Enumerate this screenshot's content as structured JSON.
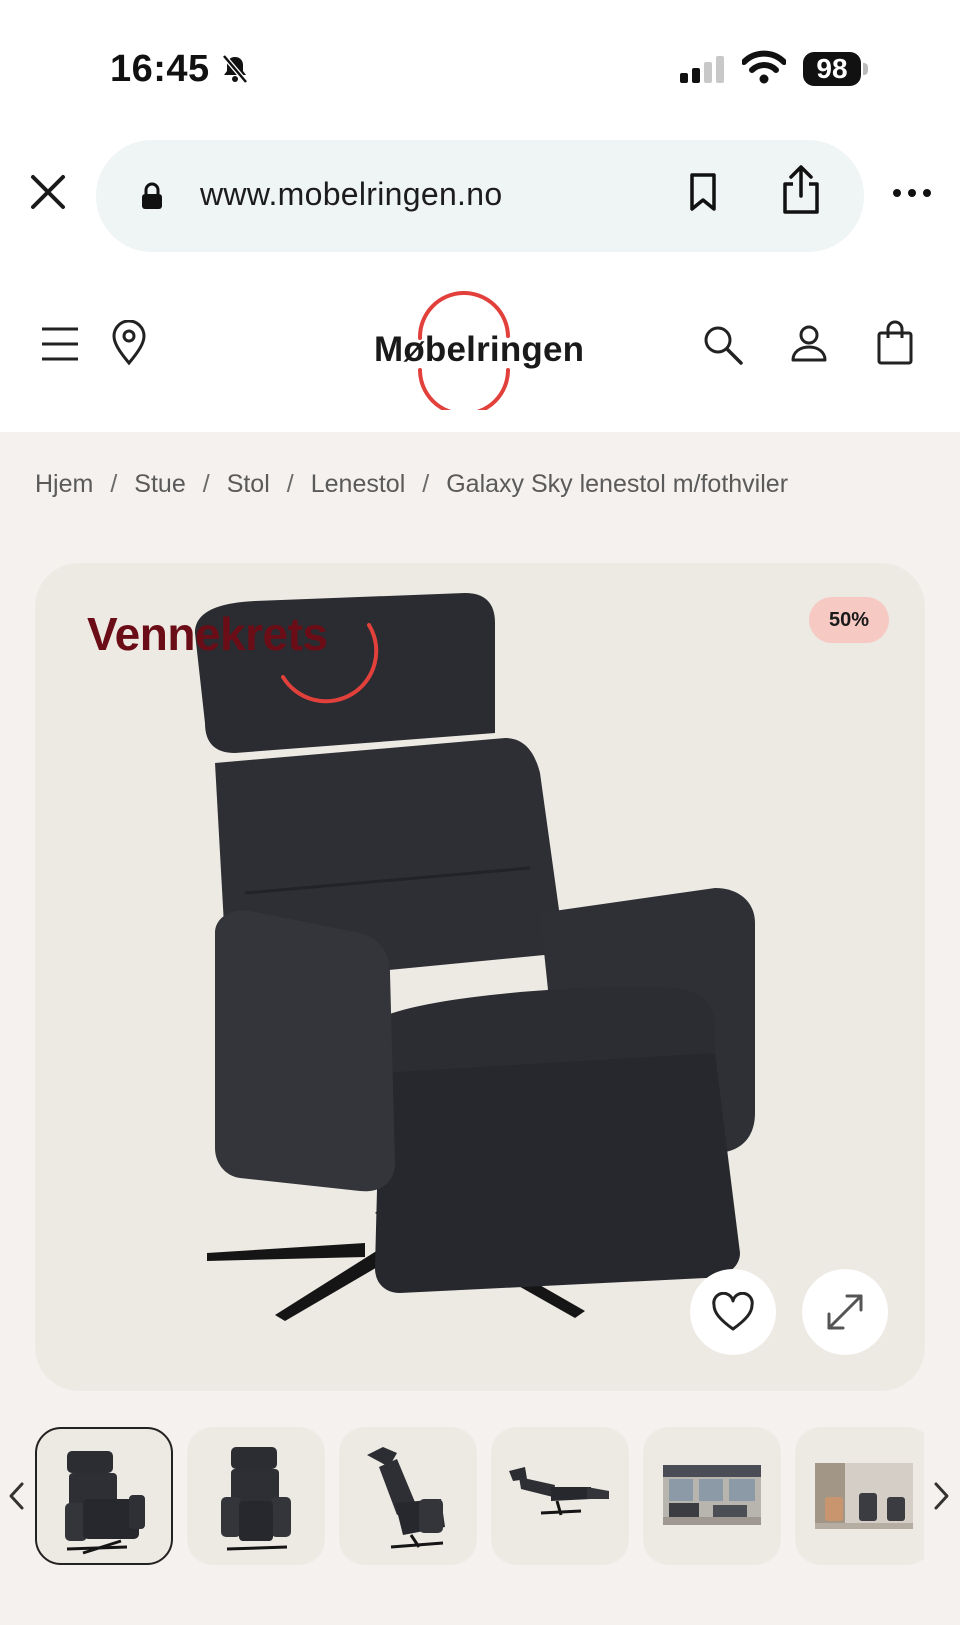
{
  "status_bar": {
    "time": "16:45",
    "battery": "98"
  },
  "browser": {
    "url": "www.mobelringen.no"
  },
  "site": {
    "logo_text": "Møbelringen",
    "colors": {
      "accent": "#e1403b",
      "promo": "#6b0d17",
      "badge_bg": "#f6c9c3"
    }
  },
  "breadcrumb": [
    {
      "label": "Hjem"
    },
    {
      "label": "Stue"
    },
    {
      "label": "Stol"
    },
    {
      "label": "Lenestol"
    },
    {
      "label": "Galaxy Sky lenestol m/fothviler"
    }
  ],
  "breadcrumb_separator": "/",
  "product": {
    "promo_label": "Vennekrets",
    "discount_badge": "50%"
  },
  "gallery": {
    "thumbnails": [
      {
        "name": "chair-front"
      },
      {
        "name": "chair-side-front"
      },
      {
        "name": "chair-side"
      },
      {
        "name": "chair-reclined"
      },
      {
        "name": "living-room-photo"
      },
      {
        "name": "room-photo"
      }
    ]
  },
  "icons": [
    "close-icon",
    "lock-icon",
    "bookmark-icon",
    "share-icon",
    "more-icon",
    "menu-icon",
    "location-pin-icon",
    "search-icon",
    "account-icon",
    "shopping-bag-icon",
    "heart-icon",
    "expand-icon",
    "chevron-left-icon",
    "chevron-right-icon"
  ]
}
